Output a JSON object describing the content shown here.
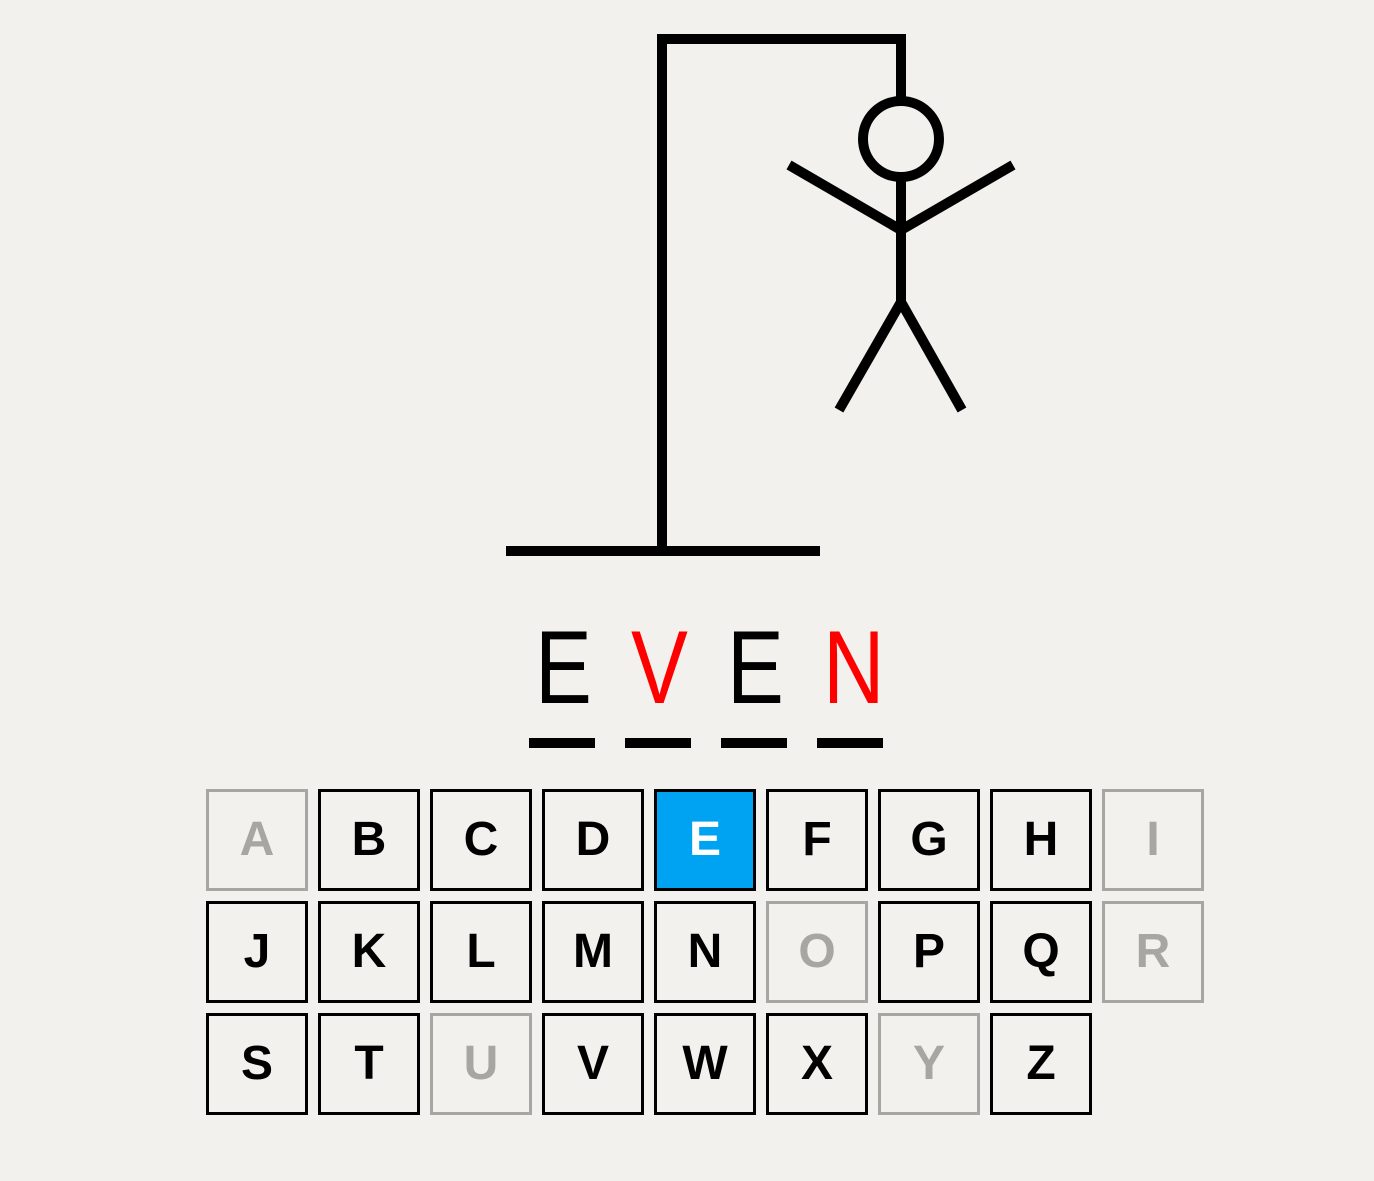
{
  "colors": {
    "background": "#f2f1ed",
    "correct": "#000000",
    "revealed": "#ff0000",
    "used": "#a7a6a2",
    "active": "#00a2f2"
  },
  "word": [
    {
      "letter": "E",
      "state": "correct"
    },
    {
      "letter": "V",
      "state": "revealed"
    },
    {
      "letter": "E",
      "state": "correct"
    },
    {
      "letter": "N",
      "state": "revealed"
    }
  ],
  "keyboard": {
    "rows": [
      [
        {
          "label": "A",
          "state": "used"
        },
        {
          "label": "B",
          "state": "available"
        },
        {
          "label": "C",
          "state": "available"
        },
        {
          "label": "D",
          "state": "available"
        },
        {
          "label": "E",
          "state": "active"
        },
        {
          "label": "F",
          "state": "available"
        },
        {
          "label": "G",
          "state": "available"
        },
        {
          "label": "H",
          "state": "available"
        },
        {
          "label": "I",
          "state": "used"
        }
      ],
      [
        {
          "label": "J",
          "state": "available"
        },
        {
          "label": "K",
          "state": "available"
        },
        {
          "label": "L",
          "state": "available"
        },
        {
          "label": "M",
          "state": "available"
        },
        {
          "label": "N",
          "state": "available"
        },
        {
          "label": "O",
          "state": "used"
        },
        {
          "label": "P",
          "state": "available"
        },
        {
          "label": "Q",
          "state": "available"
        },
        {
          "label": "R",
          "state": "used"
        }
      ],
      [
        {
          "label": "S",
          "state": "available"
        },
        {
          "label": "T",
          "state": "available"
        },
        {
          "label": "U",
          "state": "used"
        },
        {
          "label": "V",
          "state": "available"
        },
        {
          "label": "W",
          "state": "available"
        },
        {
          "label": "X",
          "state": "available"
        },
        {
          "label": "Y",
          "state": "used"
        },
        {
          "label": "Z",
          "state": "available"
        }
      ]
    ]
  }
}
